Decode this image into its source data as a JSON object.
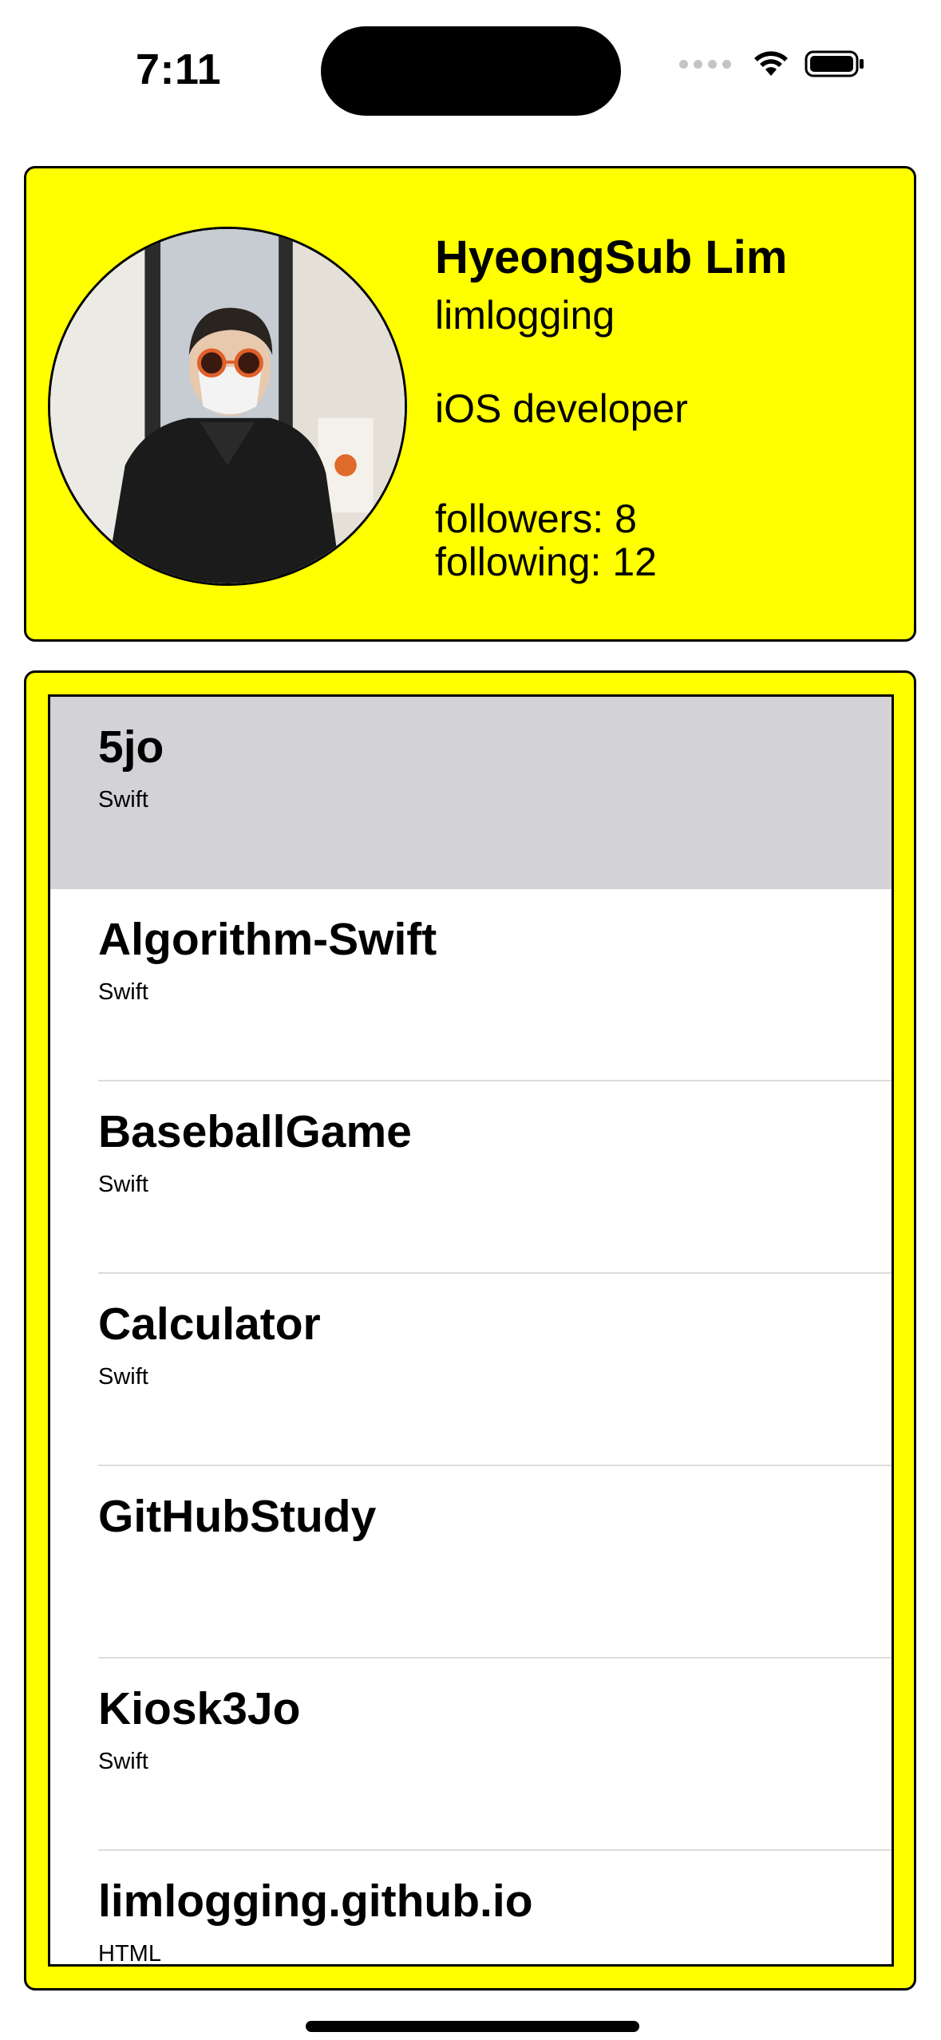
{
  "status_bar": {
    "time": "7:11",
    "icons": [
      "cellular-signal-icon",
      "wifi-icon",
      "battery-icon"
    ]
  },
  "profile": {
    "name": "HyeongSub Lim",
    "login": "limlogging",
    "bio": "iOS developer",
    "followers": "followers: 8",
    "following": "following: 12",
    "avatar": "profile-photo"
  },
  "repositories": [
    {
      "name": "5jo",
      "language": "Swift",
      "selected": true
    },
    {
      "name": "Algorithm-Swift",
      "language": "Swift",
      "selected": false
    },
    {
      "name": "BaseballGame",
      "language": "Swift",
      "selected": false
    },
    {
      "name": "Calculator",
      "language": "Swift",
      "selected": false
    },
    {
      "name": "GitHubStudy",
      "language": "",
      "selected": false
    },
    {
      "name": "Kiosk3Jo",
      "language": "Swift",
      "selected": false
    },
    {
      "name": "limlogging.github.io",
      "language": "HTML",
      "selected": false
    }
  ],
  "colors": {
    "card_background": "#ffff00",
    "selected_row": "#d2d2d7",
    "border": "#000000"
  }
}
